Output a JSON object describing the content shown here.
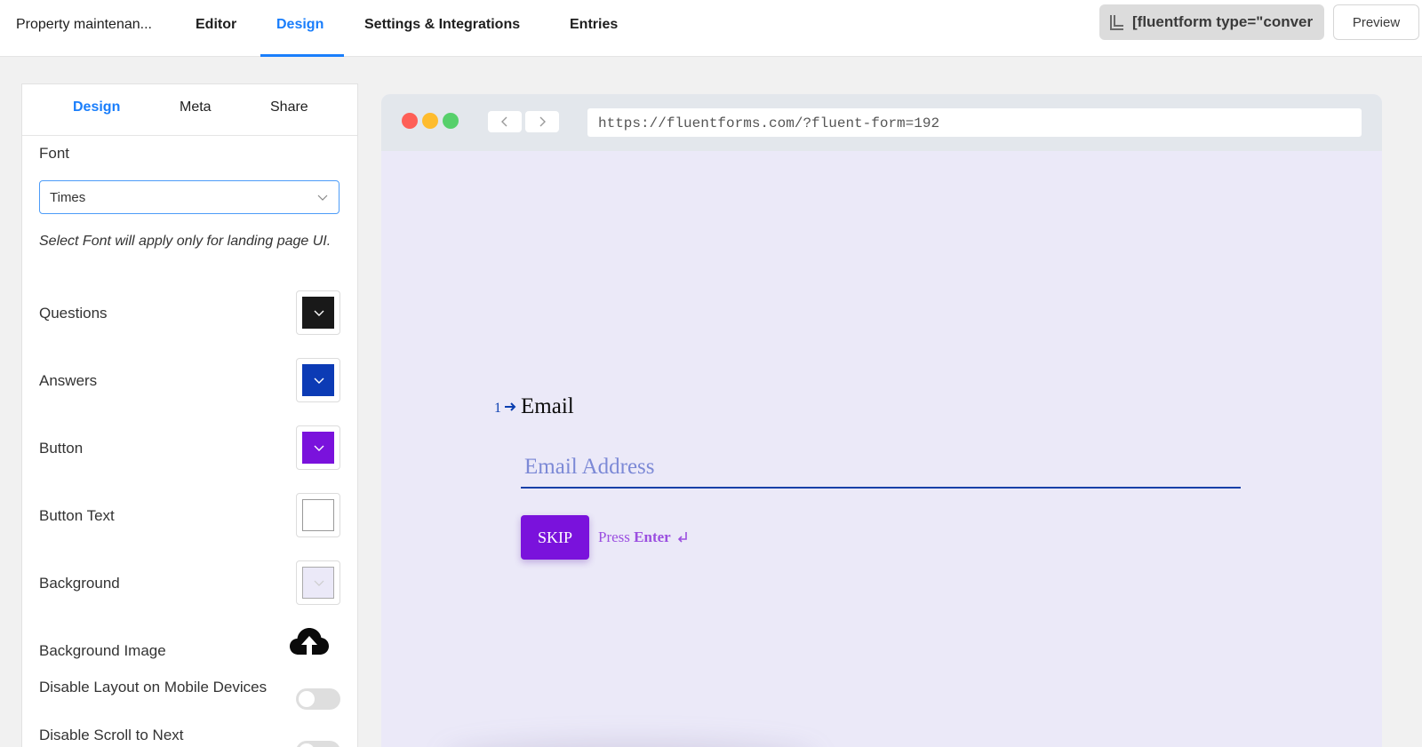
{
  "header": {
    "form_title": "Property maintenan...",
    "tabs": [
      {
        "label": "Editor"
      },
      {
        "label": "Design"
      },
      {
        "label": "Settings & Integrations"
      },
      {
        "label": "Entries"
      }
    ],
    "active_tab": "Design",
    "shortcode": "[fluentform type=\"conver",
    "preview_label": "Preview"
  },
  "sidebar": {
    "tabs": [
      {
        "label": "Design"
      },
      {
        "label": "Meta"
      },
      {
        "label": "Share"
      }
    ],
    "font_label": "Font",
    "font_value": "Times",
    "font_hint": "Select Font will apply only for landing page UI.",
    "colors": [
      {
        "label": "Questions",
        "color": "#191919"
      },
      {
        "label": "Answers",
        "color": "#0c3bb5"
      },
      {
        "label": "Button",
        "color": "#7a12dc"
      },
      {
        "label": "Button Text",
        "color": "#ffffff"
      },
      {
        "label": "Background",
        "color": "#ebe9f8"
      }
    ],
    "background_image_label": "Background Image",
    "toggles": [
      {
        "label": "Disable Layout on Mobile Devices",
        "on": false
      },
      {
        "label": "Disable Scroll to Next",
        "on": false
      }
    ]
  },
  "preview": {
    "url": "https://fluentforms.com/?fluent-form=192",
    "question_number": "1",
    "question_label": "Email",
    "answer_placeholder": "Email Address",
    "skip_label": "SKIP",
    "press_text": "Press",
    "enter_text": "Enter"
  },
  "colors": {
    "accent": "#1a7efb",
    "button": "#7a12dc",
    "answer": "#1640a8",
    "background": "#ebe9f8"
  }
}
